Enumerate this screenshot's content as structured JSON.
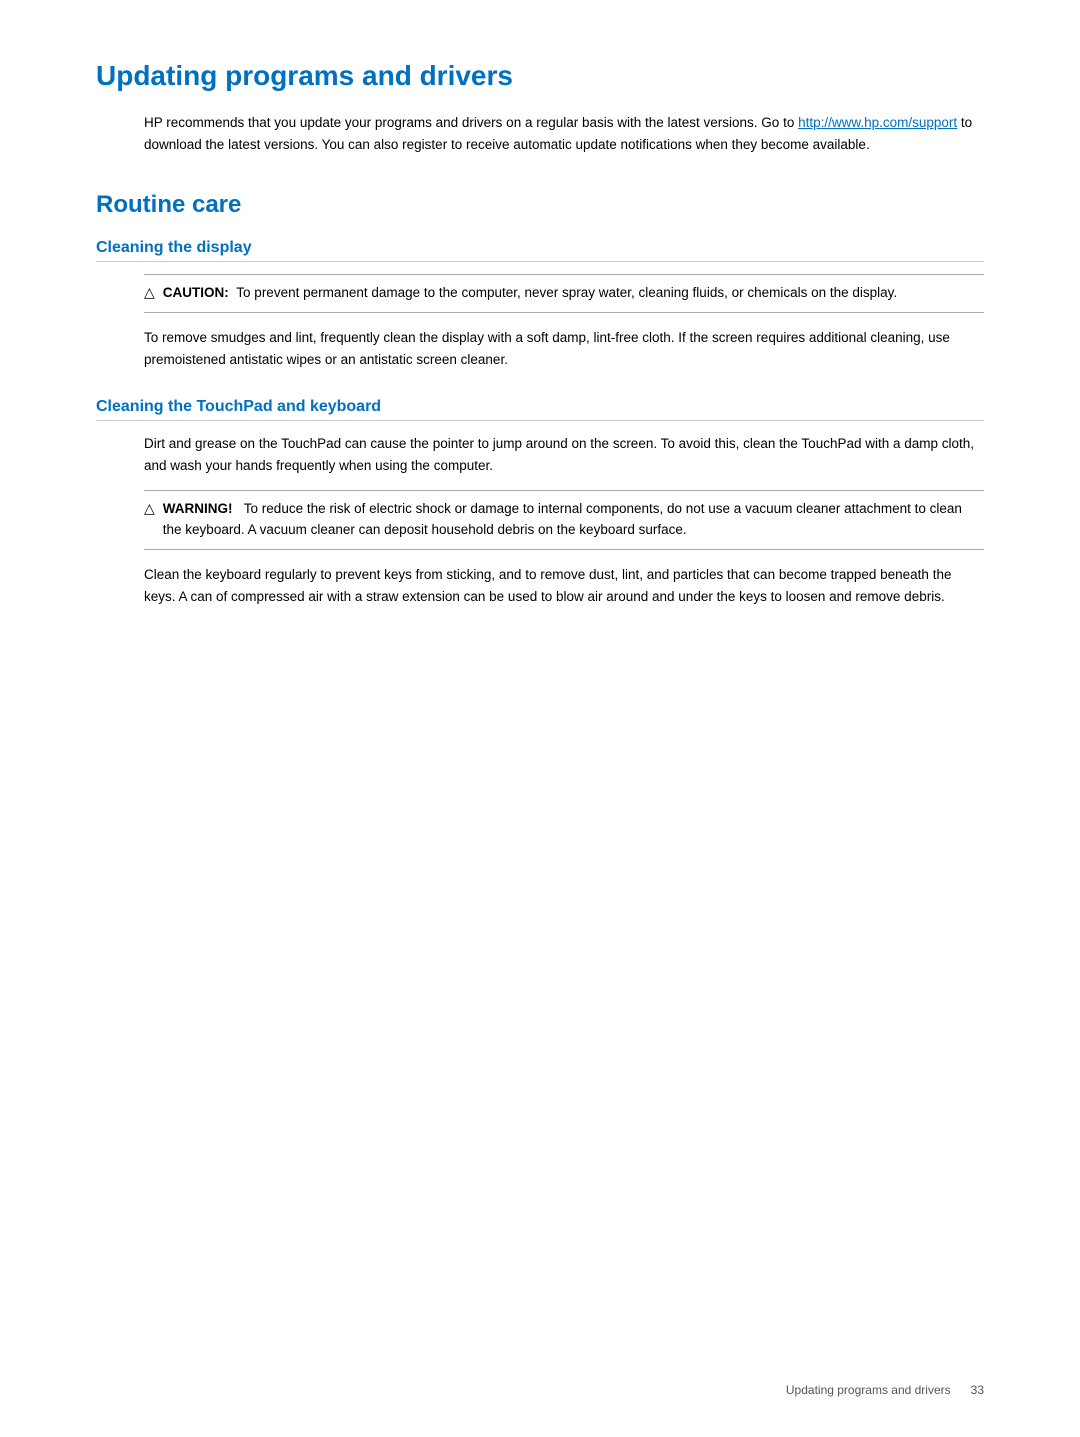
{
  "page": {
    "background": "#ffffff"
  },
  "section1": {
    "title": "Updating programs and drivers",
    "intro": "HP recommends that you update your programs and drivers on a regular basis with the latest versions. Go to ",
    "link_text": "http://www.hp.com/support",
    "link_url": "http://www.hp.com/support",
    "intro_continued": " to download the latest versions. You can also register to receive automatic update notifications when they become available."
  },
  "section2": {
    "title": "Routine care",
    "subsections": [
      {
        "id": "cleaning-display",
        "title": "Cleaning the display",
        "caution": {
          "type": "CAUTION",
          "label": "CAUTION:",
          "text": "To prevent permanent damage to the computer, never spray water, cleaning fluids, or chemicals on the display."
        },
        "body": "To remove smudges and lint, frequently clean the display with a soft damp, lint-free cloth. If the screen requires additional cleaning, use premoistened antistatic wipes or an antistatic screen cleaner."
      },
      {
        "id": "cleaning-touchpad",
        "title": "Cleaning the TouchPad and keyboard",
        "body1": "Dirt and grease on the TouchPad can cause the pointer to jump around on the screen. To avoid this, clean the TouchPad with a damp cloth, and wash your hands frequently when using the computer.",
        "warning": {
          "type": "WARNING",
          "label": "WARNING!",
          "text": "To reduce the risk of electric shock or damage to internal components, do not use a vacuum cleaner attachment to clean the keyboard. A vacuum cleaner can deposit household debris on the keyboard surface."
        },
        "body2": "Clean the keyboard regularly to prevent keys from sticking, and to remove dust, lint, and particles that can become trapped beneath the keys. A can of compressed air with a straw extension can be used to blow air around and under the keys to loosen and remove debris."
      }
    ]
  },
  "footer": {
    "label": "Updating programs and drivers",
    "page_number": "33"
  }
}
